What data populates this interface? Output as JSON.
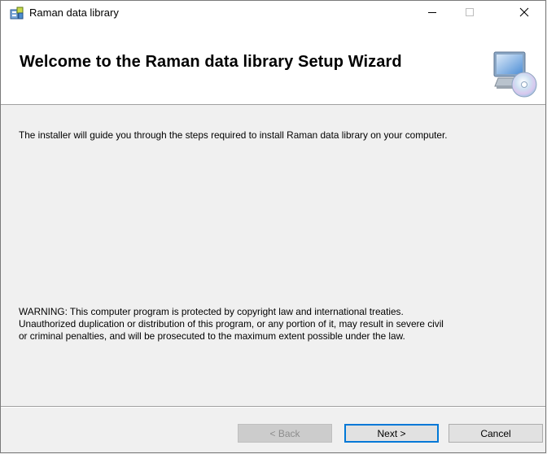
{
  "window": {
    "title": "Raman data library",
    "app_icon": "installer-package-icon",
    "controls": {
      "minimize_icon": "minimize-icon",
      "maximize_icon": "maximize-icon",
      "close_icon": "close-icon"
    }
  },
  "banner": {
    "title": "Welcome to the Raman data library Setup Wizard",
    "icon": "computer-disc-icon"
  },
  "content": {
    "intro": "The installer will guide you through the steps required to install Raman data library on your computer.",
    "warning_lines": [
      "WARNING: This computer program is protected by copyright law and international treaties.",
      "Unauthorized duplication or distribution of this program, or any portion of it, may result in severe civil",
      "or criminal penalties, and will be prosecuted to the maximum extent possible under the law."
    ]
  },
  "buttons": {
    "back": "< Back",
    "next": "Next >",
    "cancel": "Cancel"
  },
  "colors": {
    "window_bg": "#f0f0f0",
    "banner_bg": "#ffffff",
    "focus_accent": "#0078d7"
  }
}
